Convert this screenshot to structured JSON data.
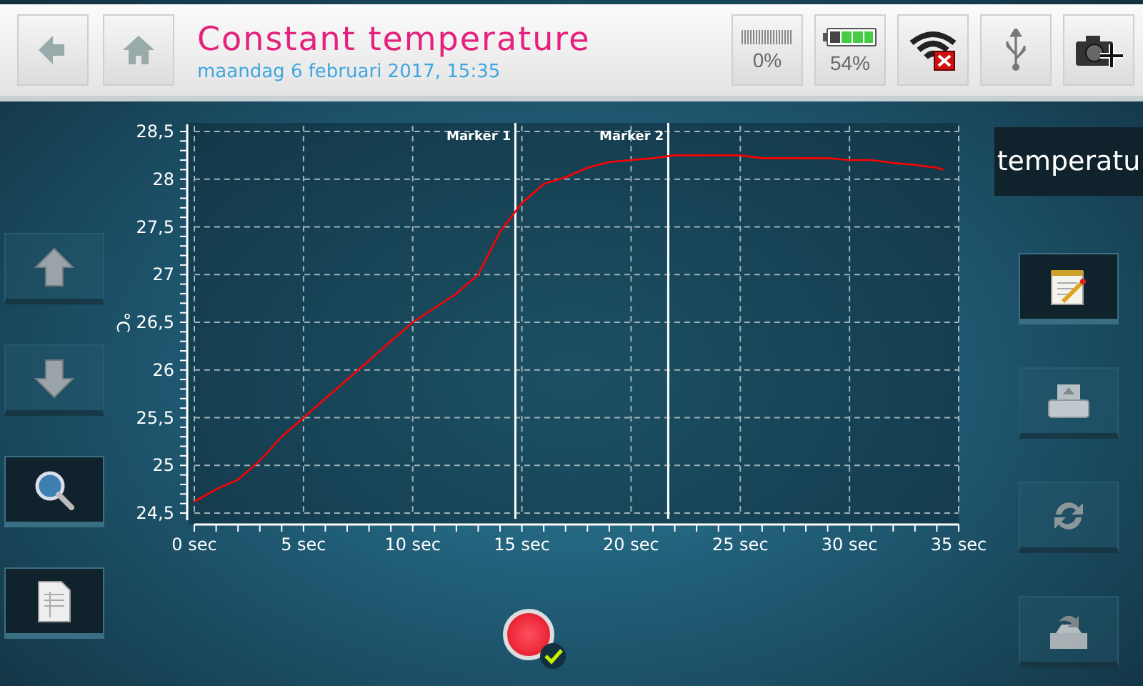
{
  "header": {
    "title": "Constant temperature",
    "datetime": "maandag 6 februari 2017, 15:35"
  },
  "nav": [
    {
      "kind": "back"
    },
    {
      "kind": "home"
    }
  ],
  "status": [
    {
      "kind": "gauge",
      "reading": "0%"
    },
    {
      "kind": "battery",
      "reading": "54%"
    },
    {
      "kind": "wifi"
    },
    {
      "kind": "usb"
    },
    {
      "kind": "camera"
    }
  ],
  "left_tools": [
    {
      "kind": "up",
      "disabled": true
    },
    {
      "kind": "down",
      "disabled": true
    },
    {
      "kind": "zoom",
      "disabled": false
    },
    {
      "kind": "document",
      "disabled": false
    }
  ],
  "channel": {
    "label": "temperatu"
  },
  "right_tools": [
    {
      "kind": "notes",
      "disabled": false
    },
    {
      "kind": "print",
      "disabled": true
    },
    {
      "kind": "refresh",
      "disabled": true
    },
    {
      "kind": "import",
      "disabled": true
    }
  ],
  "chart": {
    "chart_data": {
      "type": "line",
      "ylabel": "°C",
      "x": [
        0,
        1,
        2,
        3,
        4,
        5,
        6,
        7,
        8,
        9,
        10,
        11,
        12,
        13,
        14,
        15,
        16,
        17,
        18,
        19,
        20,
        21,
        22,
        23,
        24,
        25,
        26,
        27,
        28,
        29,
        30,
        31,
        32,
        33,
        34,
        34.3
      ],
      "grid": true,
      "series": [
        {
          "color": "#ff0000",
          "values": [
            24.62,
            24.75,
            24.85,
            25.05,
            25.3,
            25.5,
            25.7,
            25.9,
            26.1,
            26.3,
            26.5,
            26.65,
            26.8,
            27.0,
            27.45,
            27.75,
            27.95,
            28.02,
            28.12,
            28.18,
            28.2,
            28.22,
            28.25,
            28.25,
            28.25,
            28.25,
            28.22,
            28.22,
            28.22,
            28.22,
            28.2,
            28.2,
            28.17,
            28.15,
            28.12,
            28.1
          ]
        }
      ],
      "xlim": [
        0,
        35
      ],
      "ylim": [
        24.5,
        28.5
      ],
      "xticks": [
        {
          "value": 0,
          "label": "0 sec"
        },
        {
          "value": 5,
          "label": "5 sec"
        },
        {
          "value": 10,
          "label": "10 sec"
        },
        {
          "value": 15,
          "label": "15 sec"
        },
        {
          "value": 20,
          "label": "20 sec"
        },
        {
          "value": 25,
          "label": "25 sec"
        },
        {
          "value": 30,
          "label": "30 sec"
        },
        {
          "value": 35,
          "label": "35 sec"
        }
      ],
      "yticks": [
        {
          "value": 24.5,
          "label": "24,5"
        },
        {
          "value": 25,
          "label": "25"
        },
        {
          "value": 25.5,
          "label": "25,5"
        },
        {
          "value": 26,
          "label": "26"
        },
        {
          "value": 26.5,
          "label": "26,5"
        },
        {
          "value": 27,
          "label": "27"
        },
        {
          "value": 27.5,
          "label": "27,5"
        },
        {
          "value": 28,
          "label": "28"
        },
        {
          "value": 28.5,
          "label": "28,5"
        }
      ],
      "ref_lines": [
        {
          "axis": "x",
          "value": 14.7,
          "label": "Marker 1",
          "color": "#ffffff"
        },
        {
          "axis": "x",
          "value": 21.7,
          "label": "Marker 2",
          "color": "#ffffff"
        }
      ]
    }
  },
  "record_button": {
    "checked": true
  }
}
